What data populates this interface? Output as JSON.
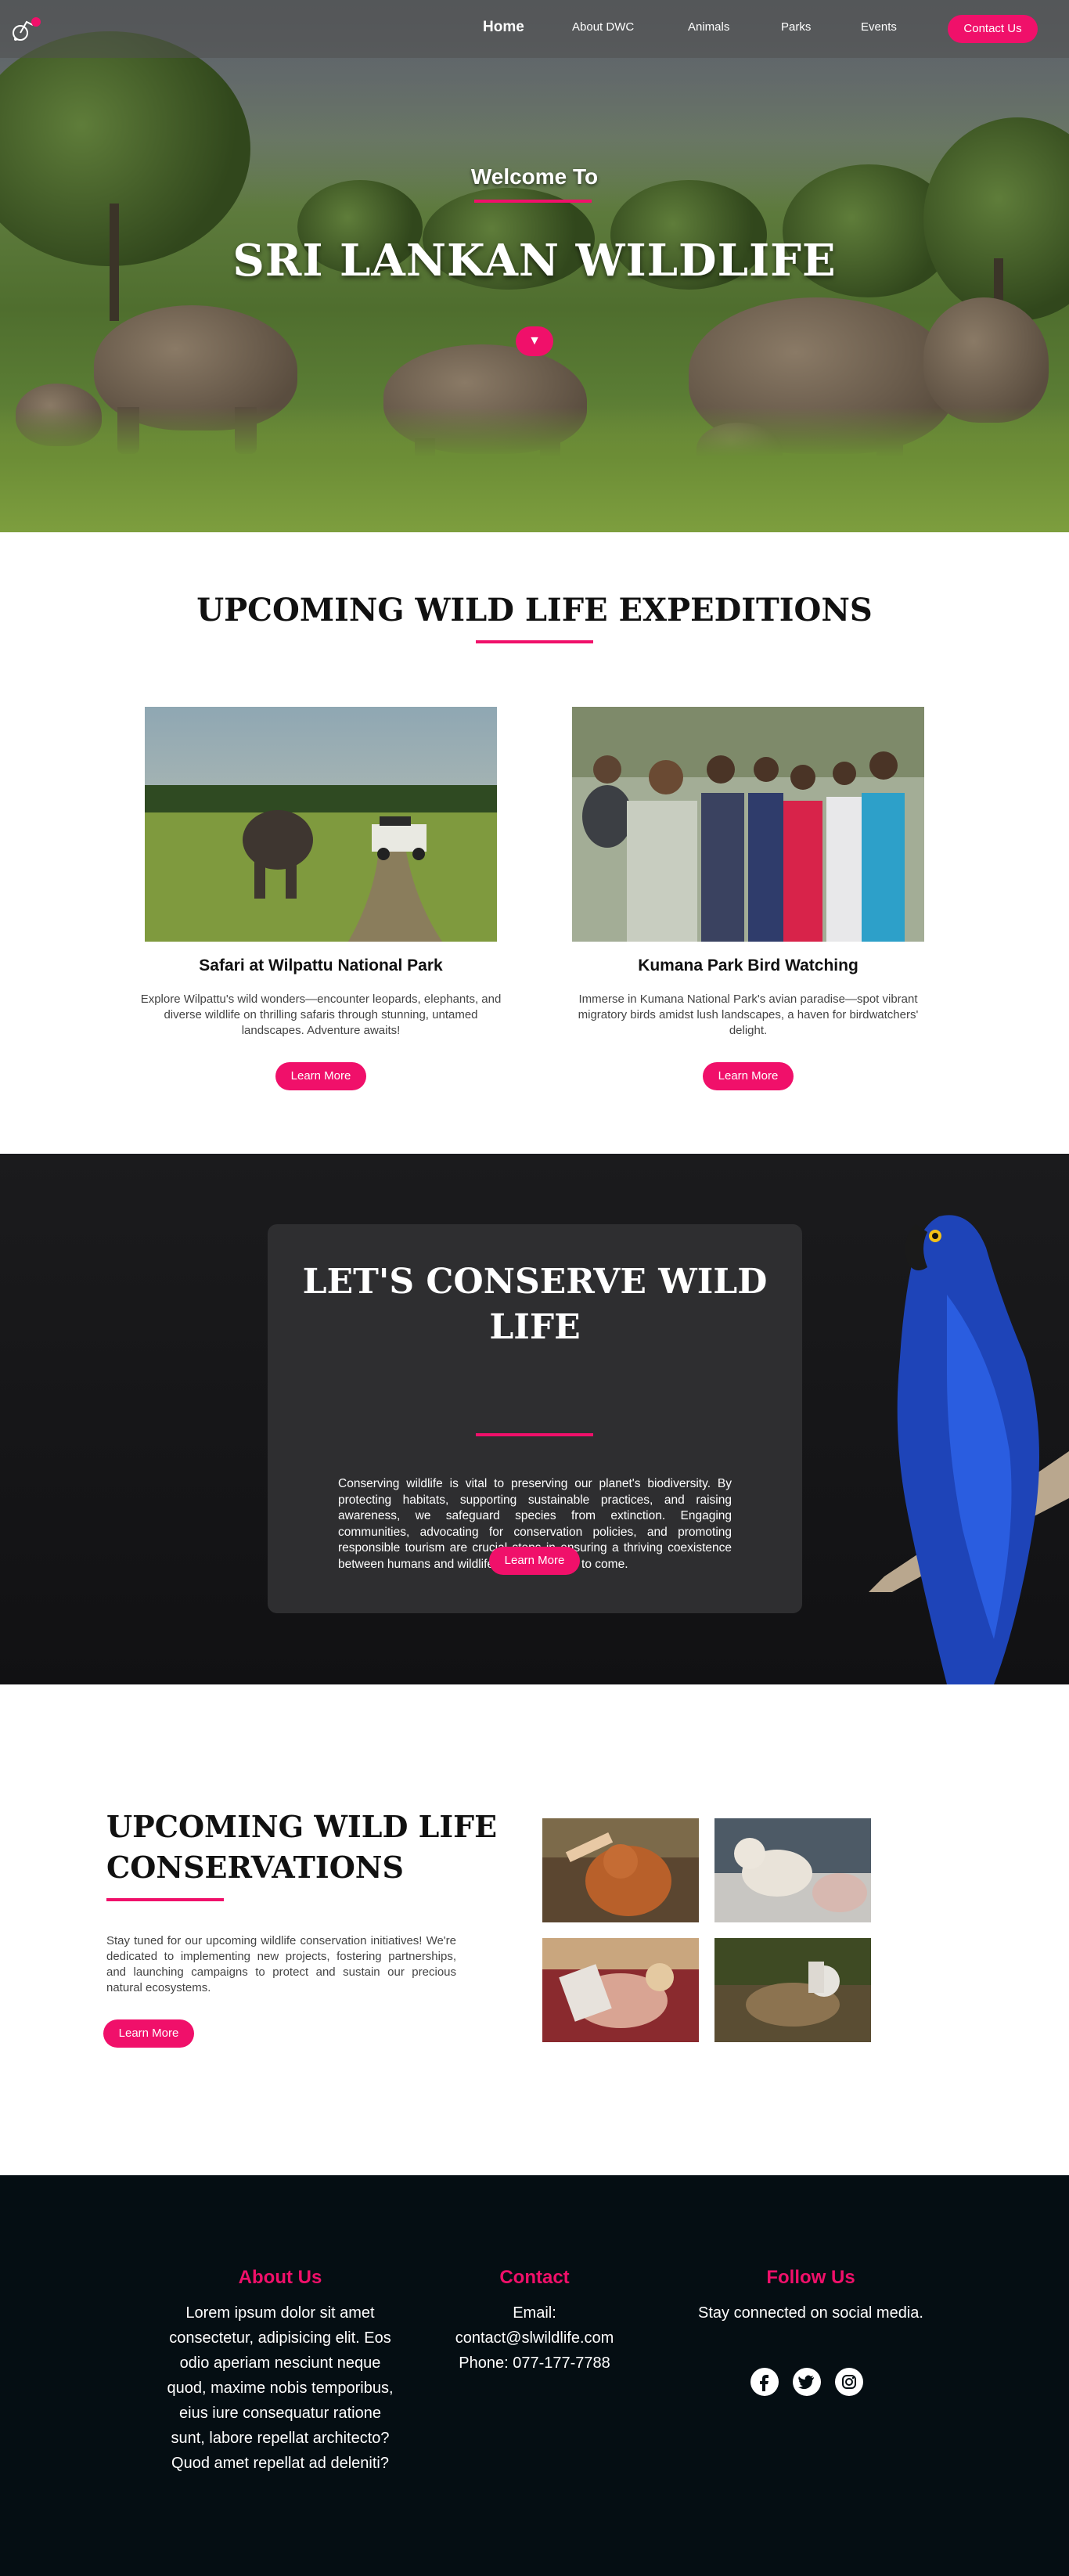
{
  "nav": {
    "links": [
      "Home",
      "About DWC",
      "Animals",
      "Parks",
      "Events"
    ],
    "contact_label": "Contact Us"
  },
  "hero": {
    "welcome": "Welcome To",
    "title": "SRI LANKAN WILDLIFE",
    "scroll_glyph": "▼"
  },
  "expeditions": {
    "heading": "UPCOMING WILD LIFE EXPEDITIONS",
    "cards": [
      {
        "title": "Safari at Wilpattu National Park",
        "text": "Explore Wilpattu's wild wonders—encounter leopards, elephants, and diverse wildlife on thrilling safaris through stunning, untamed landscapes. Adventure awaits!",
        "button": "Learn More"
      },
      {
        "title": "Kumana Park Bird Watching",
        "text": "Immerse in Kumana National Park's avian paradise—spot vibrant migratory birds amidst lush landscapes, a haven for birdwatchers' delight.",
        "button": "Learn More"
      }
    ]
  },
  "conserve": {
    "title": "LET'S CONSERVE WILD LIFE",
    "text": "Conserving wildlife is vital to preserving our planet's biodiversity. By protecting habitats, supporting sustainable practices, and raising awareness, we safeguard species from extinction. Engaging communities, advocating for conservation policies, and promoting responsible tourism are crucial steps in ensuring a thriving coexistence between humans and wildlife for generations to come.",
    "button": "Learn More"
  },
  "conservations": {
    "heading": "UPCOMING WILD LIFE CONSERVATIONS",
    "text": "Stay tuned for our upcoming wildlife conservation initiatives! We're dedicated to implementing new projects, fostering partnerships, and launching campaigns to protect and sustain our precious natural ecosystems.",
    "button": "Learn More"
  },
  "footer": {
    "about": {
      "heading": "About Us",
      "text": "Lorem ipsum dolor sit amet consectetur, adipisicing elit. Eos odio aperiam nesciunt neque quod, maxime nobis temporibus, eius iure consequatur ratione sunt, labore repellat architecto? Quod amet repellat ad deleniti?"
    },
    "contact": {
      "heading": "Contact",
      "email_label": "Email:",
      "email": "contact@slwildlife.com",
      "phone": "Phone: 077-177-7788"
    },
    "follow": {
      "heading": "Follow Us",
      "text": "Stay connected on social media.",
      "icons": [
        "facebook-icon",
        "twitter-icon",
        "instagram-icon"
      ]
    }
  },
  "colors": {
    "accent": "#f0106a",
    "footer_bg": "#050e13",
    "dark_section_bg": "#151517",
    "card_bg": "#2e2e30"
  }
}
